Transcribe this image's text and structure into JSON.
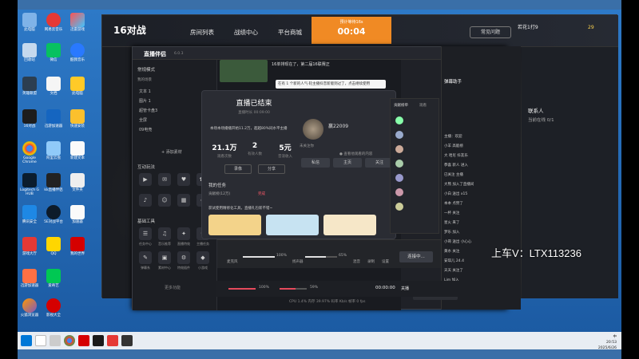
{
  "desktop": {
    "icons": [
      "此电脑",
      "网易云音乐",
      "迅雷游戏",
      "回收站",
      "微信",
      "酷我音乐",
      "英雄联盟",
      "文档",
      "此电脑",
      "16对战",
      "迅游加速器",
      "快速安装",
      "Google Chrome",
      "阿里云盘",
      "新建文本",
      "Logitech G HUB",
      "kk直播伴侣",
      "文件夹",
      "腾讯安全",
      "5E对战平台",
      "加速器",
      "游戏大厅",
      "QQ",
      "我的世界",
      "迅游加速器",
      "爱奇艺",
      "今日头条",
      "影视大全",
      "火狐浏览器",
      "文件夹"
    ]
  },
  "taskbar": {
    "time": "20:53",
    "date": "2025/6/26",
    "ime": "中"
  },
  "game": {
    "logo": "16对战",
    "nav": [
      "房间列表",
      "战绩中心",
      "平台商城"
    ],
    "timer_label": "预计等待16s",
    "timer_value": "00:04",
    "help": "常见问题",
    "user": "若花1打9",
    "coins": "29",
    "right_title": "联系人",
    "online": "当前在线 0/1"
  },
  "app": {
    "name": "直播伴侣",
    "version": "6.0.3",
    "sidebar": {
      "mode": "常规模式",
      "scene_label": "我的场景",
      "items": [
        "文本 1",
        "图片 1",
        "超管卡盘3",
        "全屏",
        "09电竞"
      ],
      "add_material": "+ 添加素材",
      "section_interact": "互动玩法",
      "section_basic": "基础工具",
      "interact_tools": [
        "互动视频",
        "弹幕玩法",
        "粉丝团",
        "连线玩法",
        "抖音时时",
        "主播口述",
        "小程序",
        "更多"
      ],
      "basic_tools": [
        "任务中心",
        "音乐推荐",
        "直播特效",
        "主播任务",
        "弹幕系",
        "素材中心",
        "特效插件",
        "小游戏"
      ],
      "more": "更多功能"
    },
    "news": "16单排现在了，第二届16联赛正",
    "tooltip": "在有 1 个新的人气·轮主播抖音新版到过了，点击继续使用"
  },
  "modal": {
    "title": "直播已结束",
    "time": "直播时长 00:09:00",
    "hint": "本场本场播播开始11.2万，超越80%同水平主播",
    "stats": [
      {
        "v": "21.1万",
        "l": "观看次数"
      },
      {
        "v": "2",
        "l": "有效人数"
      },
      {
        "v": "5元",
        "l": "音浪收入"
      }
    ],
    "btn_record": "录像",
    "btn_share": "分享",
    "tasks_title": "我的任务",
    "tasks_sub": "贡献榜(12万)",
    "tasks_link": "完成",
    "promo": "获试使用精修化工具，直播礼包新不错~",
    "audience_name": "赢22009",
    "audience_sub": "未关注你",
    "audience_follow": "● 查看他观看的内容",
    "audience_btns": [
      "私信",
      "主页",
      "关注"
    ],
    "right_title": "贡献榜单",
    "right_tab": "观看"
  },
  "mixer": {
    "mic_label": "麦克风",
    "mic_pct": "100%",
    "speaker_label": "扬声器",
    "speaker_pct": "65%",
    "connect": "连接中...",
    "btns": [
      "混音",
      "录制",
      "设置"
    ],
    "vol1": "100%",
    "vol2": "59%",
    "duration": "00:00:00",
    "stop": "关播",
    "status": "CPU 1.4%  内存 39.97%  码率 Kb/s  帧率 0 fps"
  },
  "chat": {
    "lines": [
      "主播：欢迎",
      "小羊 高能榜",
      "大 哈尼 抖友乐",
      "恭喜 新人 进入",
      "已关注 主播",
      "大熊 加入了直播间",
      "小白 送出 x15",
      "本本 点赞了",
      "一杯 关注",
      "星火 来了",
      "梦乐 加入",
      "小哥 送出 小心心",
      "黄水 关注",
      "安琪儿 24.4",
      "天天 关注了",
      "紫色 来了",
      "龙龙 x15",
      "哥哥 来了",
      "Lim 加入",
      "whblood 灵魂"
    ],
    "input_placeholder": "说点什么",
    "live_assistant": "弹幕助手"
  },
  "watermark": "上车V：LTX113236"
}
